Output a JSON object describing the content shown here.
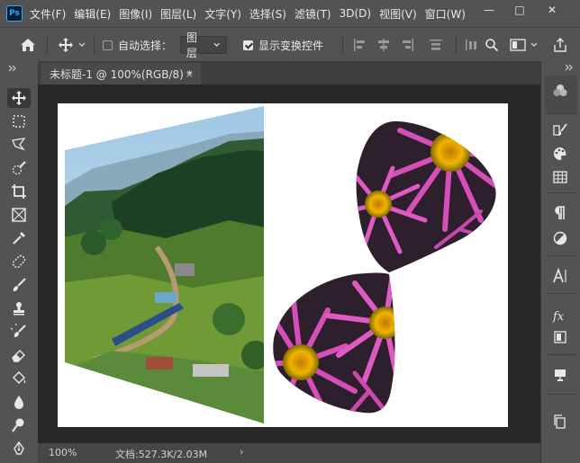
{
  "app": {
    "logo": "Ps"
  },
  "menu": [
    "文件(F)",
    "编辑(E)",
    "图像(I)",
    "图层(L)",
    "文字(Y)",
    "选择(S)",
    "滤镜(T)",
    "3D(D)",
    "视图(V)",
    "窗口(W)"
  ],
  "window_controls": {
    "minimize": "—",
    "maximize": "□",
    "close": "✕"
  },
  "options": {
    "auto_select_label": "自动选择：",
    "layer_select_value": "图层",
    "show_transform_label": "显示变换控件",
    "show_transform_checked": true,
    "auto_select_checked": false
  },
  "document": {
    "tab_title": "未标题-1 @ 100%(RGB/8) *",
    "close_glyph": "×"
  },
  "status": {
    "zoom": "100%",
    "doc_info": "文档:527.3K/2.03M",
    "arrow": "›"
  },
  "colors": {
    "panel": "#535353",
    "background": "#282828",
    "accent": "#31a8ff"
  },
  "tools": [
    "move-tool",
    "marquee-tool",
    "lasso-tool",
    "quick-select-tool",
    "crop-tool",
    "frame-tool",
    "eyedropper-tool",
    "spot-heal-tool",
    "brush-tool",
    "stamp-tool",
    "history-brush-tool",
    "eraser-tool",
    "paint-bucket-tool",
    "blur-tool",
    "dodge-tool",
    "pen-tool"
  ],
  "right_panel_icons": [
    "color-wheel",
    "swatches-history",
    "paint-palette",
    "grid-swatches",
    "paragraph",
    "adjustment",
    "character",
    "fx-styles",
    "layers-panel",
    "3d-panel",
    "copy-panel"
  ]
}
